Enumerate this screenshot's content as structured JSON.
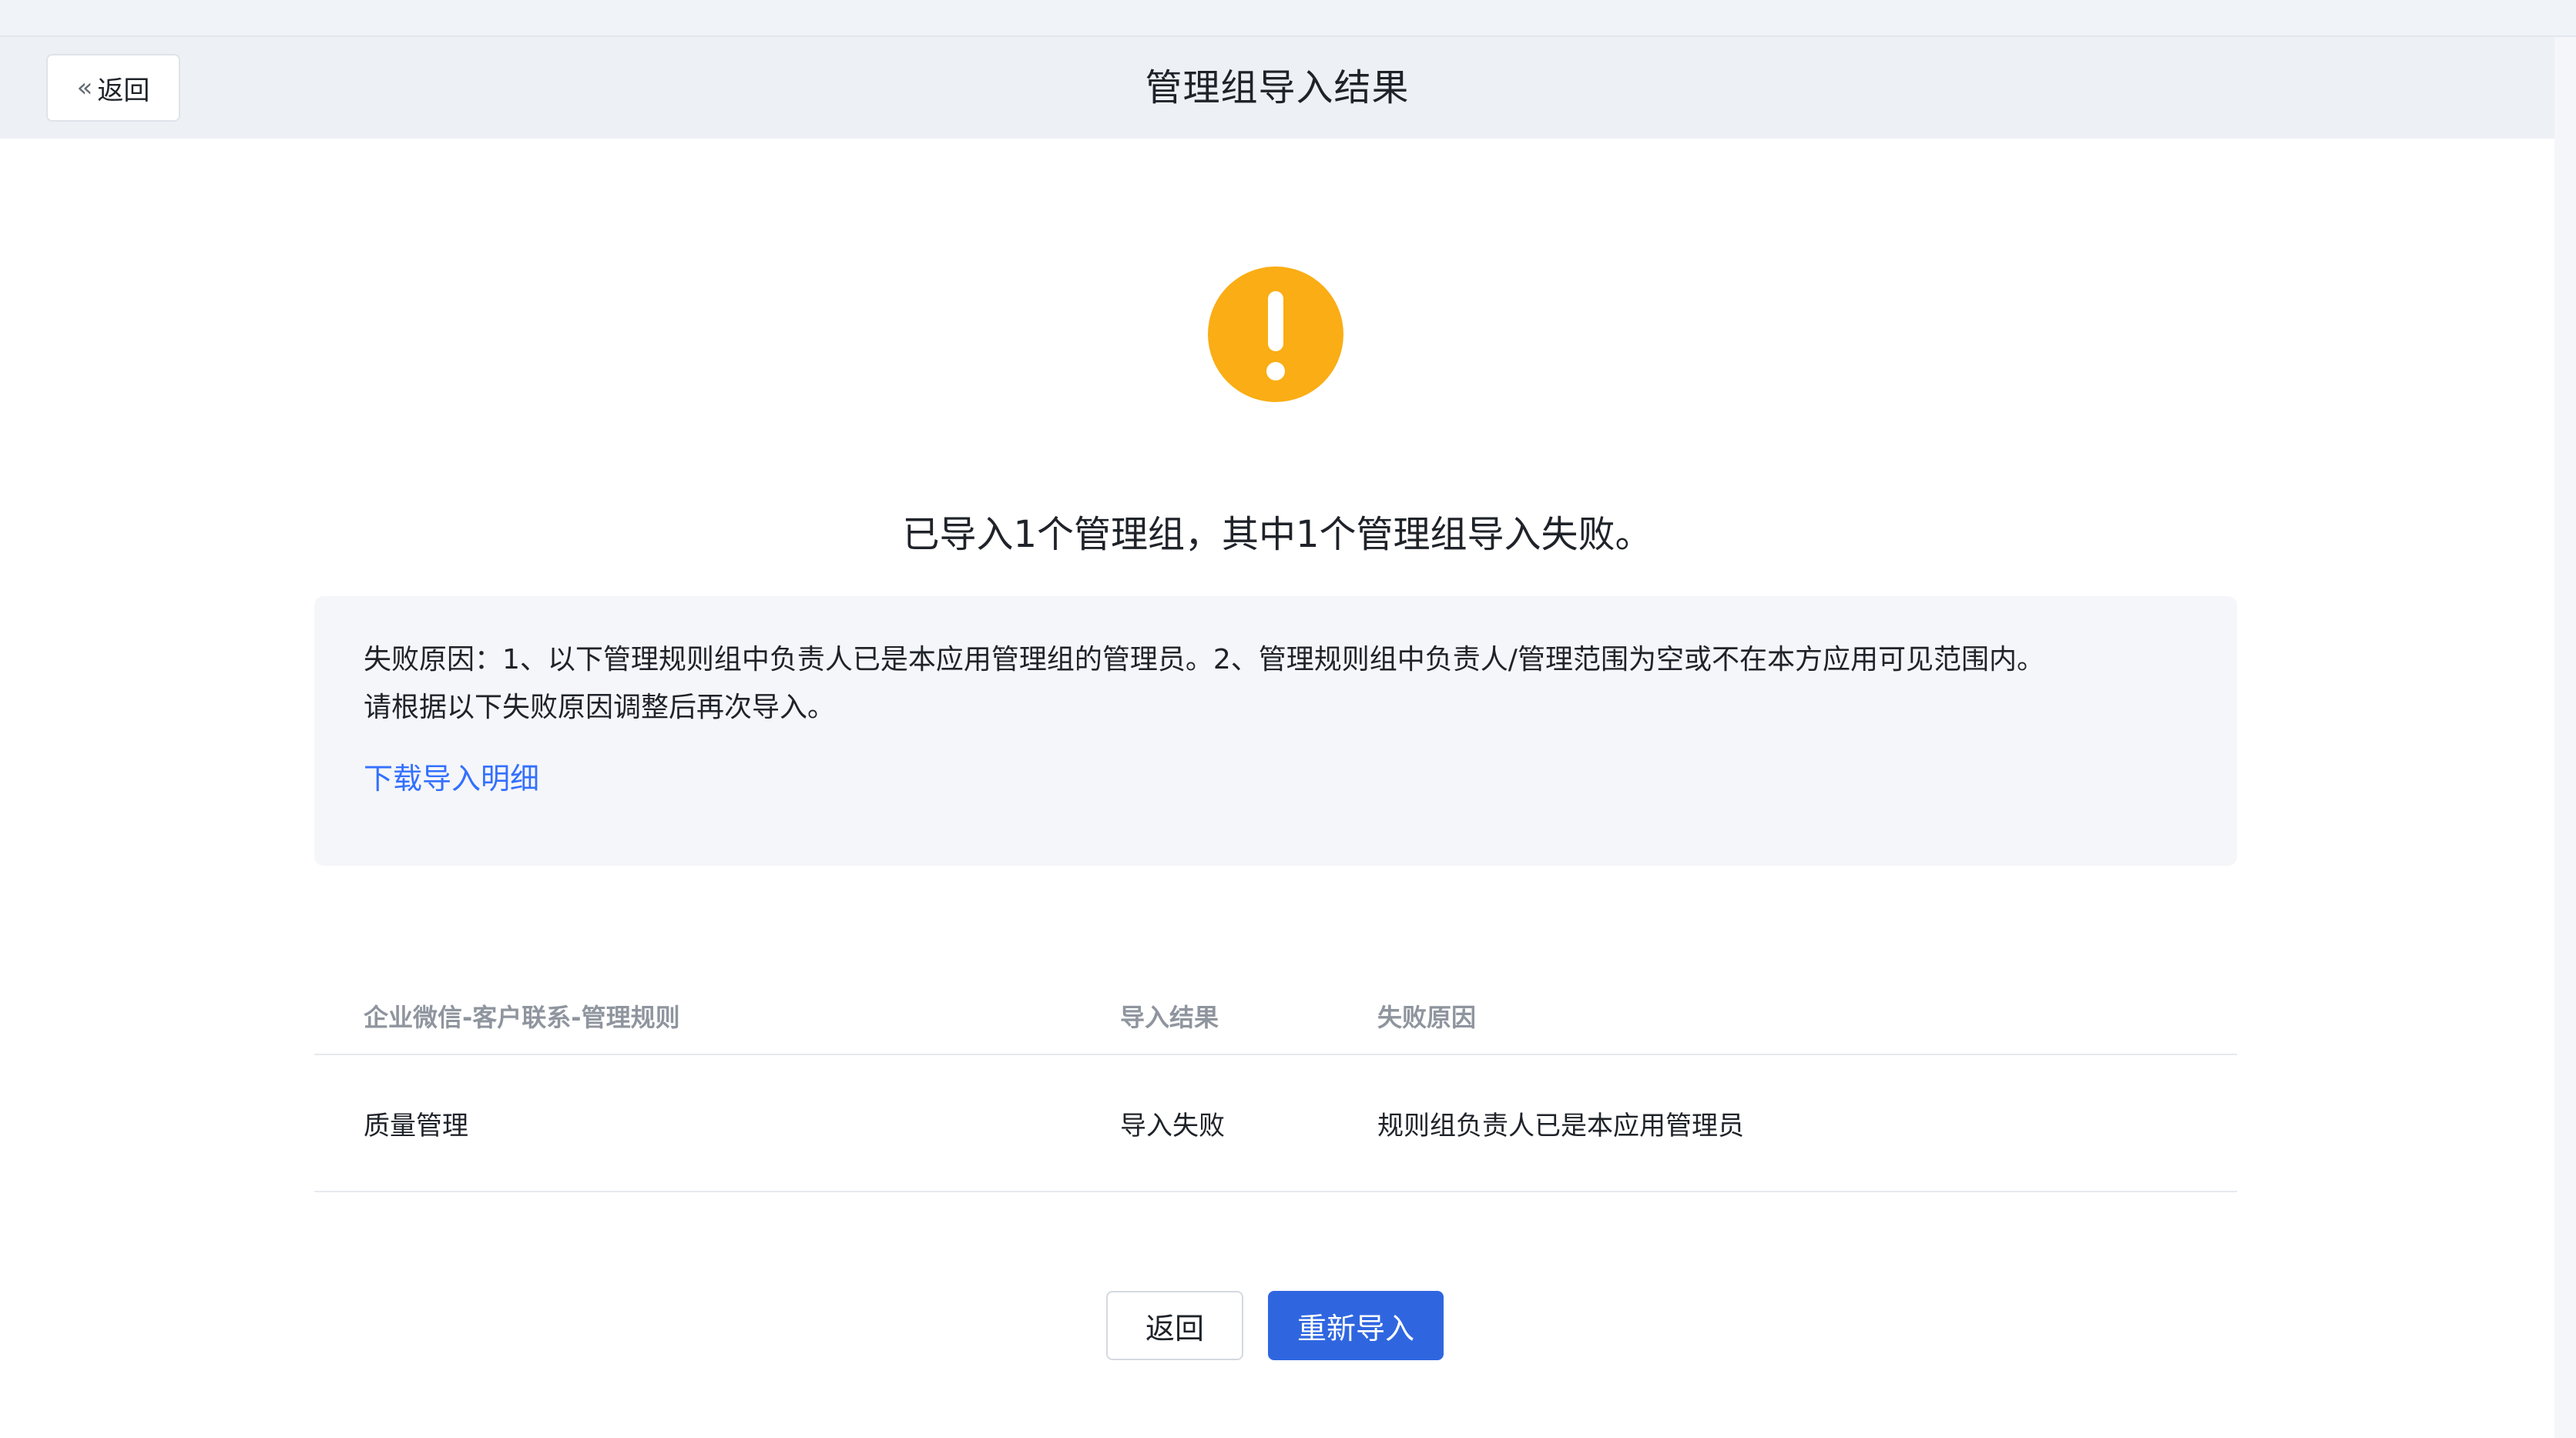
{
  "header": {
    "back_label": "返回",
    "title": "管理组导入结果"
  },
  "result": {
    "icon": "warning-icon",
    "icon_color": "#faad14",
    "summary": "已导入1个管理组，其中1个管理组导入失败。"
  },
  "reason_box": {
    "line1": "失败原因：1、以下管理规则组中负责人已是本应用管理组的管理员。2、管理规则组中负责人/管理范围为空或不在本方应用可见范围内。",
    "line2": "请根据以下失败原因调整后再次导入。",
    "download_label": "下载导入明细"
  },
  "table": {
    "columns": [
      "企业微信-客户联系-管理规则",
      "导入结果",
      "失败原因"
    ],
    "rows": [
      [
        "质量管理",
        "导入失败",
        "规则组负责人已是本应用管理员"
      ]
    ]
  },
  "actions": {
    "back_label": "返回",
    "reimport_label": "重新导入"
  },
  "colors": {
    "accent": "#2f66e0",
    "link": "#3370ff",
    "warning": "#faad14"
  }
}
